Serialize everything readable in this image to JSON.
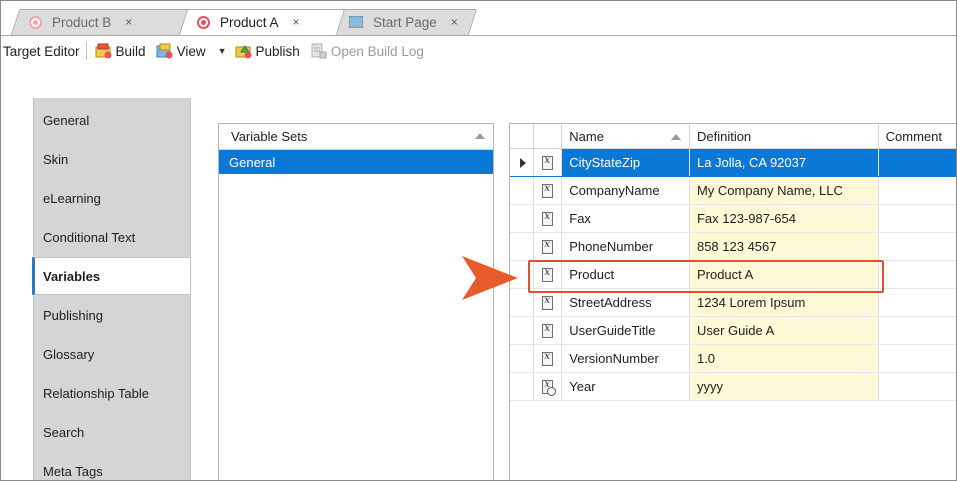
{
  "tabs": [
    {
      "label": "Product B",
      "close": "×",
      "icon": "target-icon",
      "active": false
    },
    {
      "label": "Product A",
      "close": "×",
      "icon": "target-icon",
      "active": true
    },
    {
      "label": "Start Page",
      "close": "×",
      "icon": "start-page-icon",
      "active": false
    }
  ],
  "toolbar": {
    "title": "Target Editor",
    "build": "Build",
    "view": "View",
    "publish": "Publish",
    "open_build_log": "Open Build Log"
  },
  "nav": [
    "General",
    "Skin",
    "eLearning",
    "Conditional Text",
    "Variables",
    "Publishing",
    "Glossary",
    "Relationship Table",
    "Search",
    "Meta Tags"
  ],
  "nav_active": "Variables",
  "variable_sets": {
    "header": "Variable Sets",
    "items": [
      "General"
    ],
    "selected": "General"
  },
  "grid": {
    "columns": {
      "name": "Name",
      "definition": "Definition",
      "comment": "Comment"
    },
    "rows": [
      {
        "name": "CityStateZip",
        "definition": "La Jolla, CA 92037",
        "comment": "",
        "icon": "variable-icon"
      },
      {
        "name": "CompanyName",
        "definition": "My Company Name, LLC",
        "comment": "",
        "icon": "variable-icon"
      },
      {
        "name": "Fax",
        "definition": "Fax 123-987-654",
        "comment": "",
        "icon": "variable-icon"
      },
      {
        "name": "PhoneNumber",
        "definition": "858 123 4567",
        "comment": "",
        "icon": "variable-icon"
      },
      {
        "name": "Product",
        "definition": "Product A",
        "comment": "",
        "icon": "variable-icon"
      },
      {
        "name": "StreetAddress",
        "definition": "1234 Lorem Ipsum",
        "comment": "",
        "icon": "variable-icon"
      },
      {
        "name": "UserGuideTitle",
        "definition": "User Guide A",
        "comment": "",
        "icon": "variable-icon"
      },
      {
        "name": "VersionNumber",
        "definition": "1.0",
        "comment": "",
        "icon": "variable-icon"
      },
      {
        "name": "Year",
        "definition": "yyyy",
        "comment": "",
        "icon": "date-variable-icon"
      }
    ],
    "selected_row": "CityStateZip",
    "highlighted_row": "Product"
  },
  "colors": {
    "selection": "#0a78d7",
    "definition_bg": "#fefad8",
    "callout": "#e0522c",
    "nav_bg": "#d5d5d5"
  }
}
